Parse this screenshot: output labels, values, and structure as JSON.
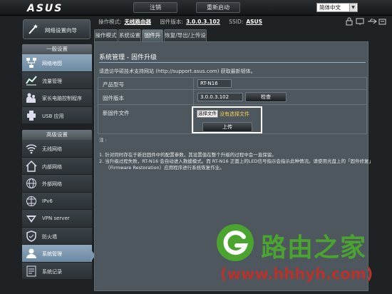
{
  "header": {
    "logo": "ASUS",
    "logout_label": "注销",
    "reboot_label": "重新启动",
    "language": "简体中文"
  },
  "quick_setup": {
    "label": "网络设置向导"
  },
  "status": {
    "mode_label": "操作模式:",
    "mode_value": "无线路由器",
    "firmware_label": "固件版本:",
    "firmware_value": "3.0.0.3.102",
    "ssid_label": "SSID:",
    "ssid_value": "ASUS"
  },
  "tabs": [
    "操作模式",
    "系统设置",
    "固件升级",
    "恢复/导出/上传设置"
  ],
  "sidebar": {
    "general_title": "一般设置",
    "general_items": [
      {
        "label": "网络地图",
        "icon": "network-map-icon"
      },
      {
        "label": "流量管理",
        "icon": "traffic-icon"
      },
      {
        "label": "家长电脑控制程序",
        "icon": "parental-control-icon"
      },
      {
        "label": "USB 应用",
        "icon": "usb-icon"
      }
    ],
    "advanced_title": "高级设置",
    "advanced_items": [
      {
        "label": "无线网络",
        "icon": "wireless-icon"
      },
      {
        "label": "内部网络",
        "icon": "lan-icon"
      },
      {
        "label": "外部网络",
        "icon": "wan-icon"
      },
      {
        "label": "IPv6",
        "icon": "ipv6-icon"
      },
      {
        "label": "VPN server",
        "icon": "vpn-icon"
      },
      {
        "label": "防火墙",
        "icon": "firewall-icon"
      },
      {
        "label": "系统管理",
        "icon": "administration-icon"
      },
      {
        "label": "系统记录",
        "icon": "system-log-icon"
      }
    ]
  },
  "main": {
    "title": "系统管理 - 固件升级",
    "description": "请造访华硕技术支持网站 (http://support.asus.com) 获取最新韧体。",
    "product_label": "产品型号",
    "product_value": "RT-N16",
    "firmware_label": "固件版本",
    "firmware_value": "3.0.0.3.102",
    "check_label": "检查",
    "new_fw_label": "新固件文件",
    "choose_file_label": "选择文件",
    "no_file_label": "没有选择文件",
    "upload_label": "上传",
    "notes_title": "注 :",
    "note1": "1.  针对同时存在于新旧固件中的配置参数，其设置值在整个升级的过程中会一直保留。",
    "note2a": "2.  当升级过程失败，RT-N16 会自动进入救援模式。而 RT-N16 正面上的LED信号指示会指示此种情况。请使用光盘上的「固件修复」",
    "note2b": "（Firmware Restoration）应用程序进行系统恢复作业。"
  },
  "watermark": {
    "text": "路由之家",
    "url": "(www.hhhyh.com)"
  },
  "colors": {
    "accent": "#7b96ad",
    "watermark_green": "#4aa42f",
    "watermark_red": "#b8322e"
  }
}
